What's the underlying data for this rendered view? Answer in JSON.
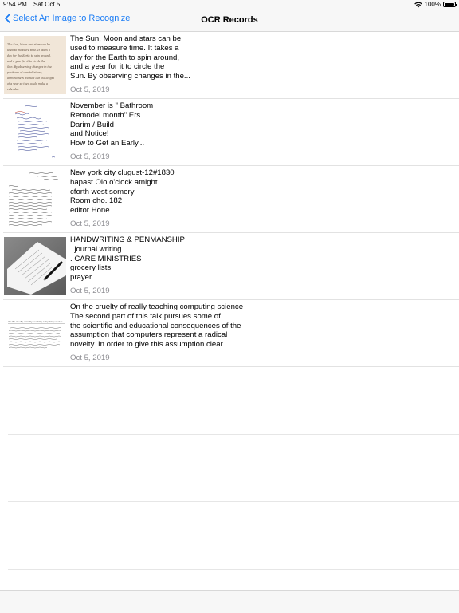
{
  "status": {
    "time": "9:54 PM",
    "date": "Sat Oct 5",
    "battery": "100%",
    "battery_level": 1.0
  },
  "nav": {
    "back_label": "Select An Image to Recognize",
    "title": "OCR Records"
  },
  "records": [
    {
      "text": "The Sun, Moon and stars can be\nused to measure time. It takes a\nday for the Earth to spin around,\nand a year for it to circle the\nSun. By observing changes in the...",
      "date": "Oct 5, 2019",
      "thumb_lines": [
        "The Sun, Moon and stars can be",
        "used to measure time. It takes a",
        "day for the Earth to spin around,",
        "and a year for it to circle the",
        "Sun. By observing changes in the",
        "positions of constellations,",
        "astronomers worked out the length",
        "of a year so they could make a",
        "calendar."
      ]
    },
    {
      "text": "November is \" Bathroom\nRemodel month\" Ers\nDarim / Build\nand Notice!\nHow to Get an Early...",
      "date": "Oct 5, 2019"
    },
    {
      "text": "New york city clugust-12#1830\nhapast Olo o'clock atnight\ncforth west somery\nRoom cho. 182\neditor Hone...",
      "date": "Oct 5, 2019"
    },
    {
      "text": "HANDWRITING & PENMANSHIP\n. journal writing\n. CARE MINISTRIES\ngrocery lists\nprayer...",
      "date": "Oct 5, 2019"
    },
    {
      "text": "On the cruelty of really teaching computing science\nThe second part of this talk pursues some of\nthe scientific and educational consequences of the\nassumption that computers represent a radical\nnovelty. In order to give this assumption clear...",
      "date": "Oct 5, 2019",
      "thumb_lines": [
        "On the cruelty of really teaching computing science"
      ]
    }
  ]
}
